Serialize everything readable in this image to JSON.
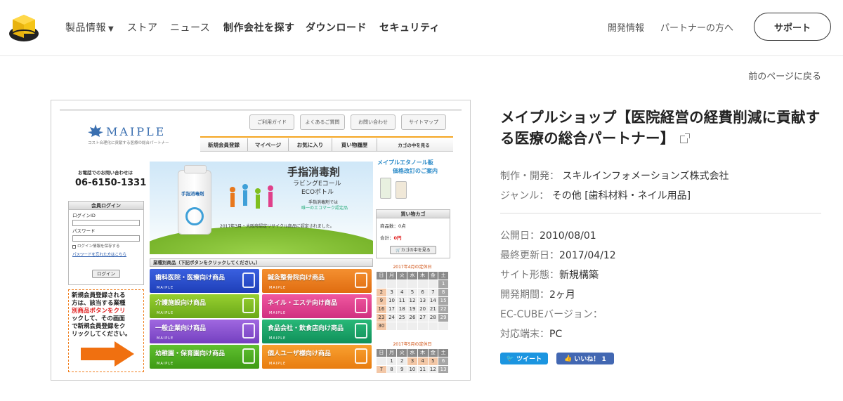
{
  "header": {
    "nav": [
      {
        "label": "製品情報"
      },
      {
        "label": "ストア"
      },
      {
        "label": "ニュース"
      },
      {
        "label": "制作会社を探す"
      },
      {
        "label": "ダウンロード"
      },
      {
        "label": "セキュリティ"
      }
    ],
    "right_nav": [
      {
        "label": "開発情報"
      },
      {
        "label": "パートナーの方へ"
      }
    ],
    "support_label": "サポート"
  },
  "back_link": "前のページに戻る",
  "shop_screenshot": {
    "top_tabs": [
      "ご利用ガイド",
      "よくあるご質問",
      "お問い合わせ",
      "サイトマップ"
    ],
    "logo_text": "MAIPLE",
    "logo_sub": "コスト合理化に貢献する医療の総合パートナー",
    "menu": [
      "新規会員登録",
      "マイページ",
      "お気に入り",
      "買い物履歴",
      "カゴの中を見る"
    ],
    "phone_label": "お電話でのお問い合わせは",
    "phone": "06-6150-1331",
    "login": {
      "title": "会員ログイン",
      "id_label": "ログインID",
      "pw_label": "パスワード",
      "remember": "ログイン情報を保存する",
      "forgot": "パスワードを忘れた方はこちら",
      "button": "ログイン"
    },
    "promo_text": [
      "新規会員登録される",
      "方は、該当する業種",
      "別商品ボタンをクリ",
      "ックして、その画面",
      "で新規会員登録をク",
      "リックしてください。"
    ],
    "banner": {
      "title": "手指消毒剤",
      "sub1": "ラビングEコール",
      "sub2": "ECOボトル",
      "note1": "手指消毒剤では",
      "note2": "唯一のエコマーク認定品",
      "bottom": "2017年3月・大阪府認定リサイクル商品に認定されました。",
      "bottle_label": "手指消毒剤"
    },
    "categories_header": "業種別商品（下記ボタンをクリックしてください。）",
    "categories": [
      {
        "label": "歯科医院・医療向け商品",
        "color": "#2a4fd0"
      },
      {
        "label": "鍼灸整骨院向け商品",
        "color": "#e8781c"
      },
      {
        "label": "介護施設向け商品",
        "color": "#7fbf1e"
      },
      {
        "label": "ネイル・エステ向け商品",
        "color": "#e0408a"
      },
      {
        "label": "一般企業向け商品",
        "color": "#8b4fc8"
      },
      {
        "label": "食品会社・飲食店向け商品",
        "color": "#19a068"
      },
      {
        "label": "幼稚園・保育園向け商品",
        "color": "#4cae1c"
      },
      {
        "label": "個人ユーザ様向け商品",
        "color": "#f2901c"
      }
    ],
    "maiple_small": "MAIPLE",
    "notice": {
      "line1": "メイプルエタノール販",
      "line2": "価格改訂のご案内"
    },
    "cart": {
      "title": "買い物カゴ",
      "count": "商品数：0点",
      "total_label": "合計：",
      "total": "0円",
      "button": "カゴの中を見る"
    },
    "cal1": {
      "title": "2017年4月の定休日",
      "days": [
        "日",
        "月",
        "火",
        "水",
        "木",
        "金",
        "土"
      ],
      "rows": [
        [
          "",
          "",
          "",
          "",
          "",
          "",
          "1"
        ],
        [
          "2",
          "3",
          "4",
          "5",
          "6",
          "7",
          "8"
        ],
        [
          "9",
          "10",
          "11",
          "12",
          "13",
          "14",
          "15"
        ],
        [
          "16",
          "17",
          "18",
          "19",
          "20",
          "21",
          "22"
        ],
        [
          "23",
          "24",
          "25",
          "26",
          "27",
          "28",
          "29"
        ],
        [
          "30",
          "",
          "",
          "",
          "",
          "",
          ""
        ]
      ]
    },
    "cal2": {
      "title": "2017年5月の定休日",
      "days": [
        "日",
        "月",
        "火",
        "水",
        "木",
        "金",
        "土"
      ],
      "rows": [
        [
          "",
          "1",
          "2",
          "3",
          "4",
          "5",
          "6"
        ],
        [
          "7",
          "8",
          "9",
          "10",
          "11",
          "12",
          "13"
        ]
      ]
    }
  },
  "detail": {
    "title": "メイプルショップ【医院経営の経費削減に貢献する医療の総合パートナー】",
    "dev_label": "制作・開発：",
    "dev_value": "スキルインフォメーションズ株式会社",
    "genre_label": "ジャンル：",
    "genre_value": "その他 [歯科材料・ネイル用品]",
    "published_label": "公開日：",
    "published_value": "2010/08/01",
    "updated_label": "最終更新日：",
    "updated_value": "2017/04/12",
    "form_label": "サイト形態：",
    "form_value": "新規構築",
    "period_label": "開発期間：",
    "period_value": "2ヶ月",
    "eccube_label": "EC-CUBEバージョン：",
    "eccube_value": "",
    "device_label": "対応端末：",
    "device_value": "PC"
  },
  "social": {
    "tweet": "ツイート",
    "like": "いいね！ 1"
  },
  "colors": {
    "accent": "#f5c518",
    "tweet": "#1b95e0",
    "facebook": "#4267b2"
  }
}
